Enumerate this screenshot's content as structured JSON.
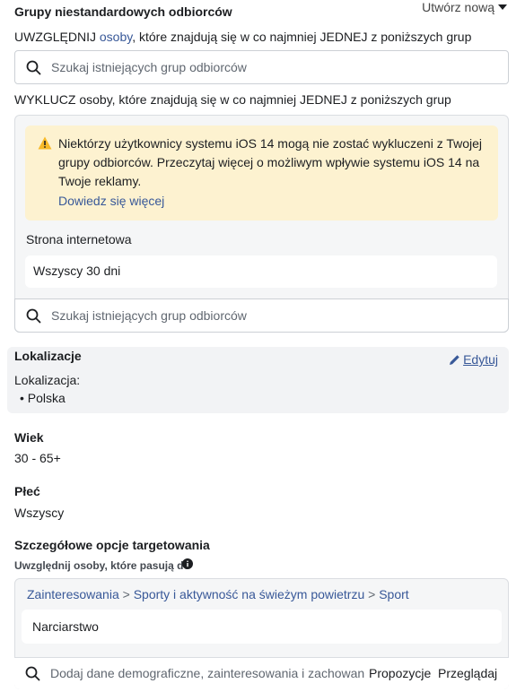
{
  "header": {
    "title": "Grupy niestandardowych odbiorców",
    "create_label": "Utwórz nową"
  },
  "include": {
    "prefix": "UWZGLĘDNIJ ",
    "link": "osoby",
    "suffix": ", które znajdują się w co najmniej JEDNEJ z poniższych grup",
    "search_placeholder": "Szukaj istniejących grup odbiorców"
  },
  "exclude": {
    "text": "WYKLUCZ osoby, które znajdują się w co najmniej JEDNEJ z poniższych grup",
    "warning_text": "Niektórzy użytkownicy systemu iOS 14 mogą nie zostać wykluczeni z Twojej grupy odbiorców. Przeczytaj więcej o możliwym wpływie systemu iOS 14 na Twoje reklamy.",
    "warning_link": "Dowiedz się więcej",
    "source_label": "Strona internetowa",
    "chip_label": "Wszyscy 30 dni",
    "search_placeholder": "Szukaj istniejących grup odbiorców"
  },
  "location": {
    "heading": "Lokalizacje",
    "edit_label": "Edytuj",
    "sub_label": "Lokalizacja:",
    "items": [
      "Polska"
    ]
  },
  "age": {
    "heading": "Wiek",
    "value": "30 - 65+"
  },
  "gender": {
    "heading": "Płeć",
    "value": "Wszyscy"
  },
  "detailed": {
    "heading": "Szczegółowe opcje targetowania",
    "sub_label": "Uwzględnij osoby, które pasują do",
    "crumbs": [
      "Zainteresowania",
      "Sporty i aktywność na świeżym powietrzu",
      "Sport"
    ],
    "chip_label": "Narciarstwo",
    "search_placeholder": "Dodaj dane demograficzne, zainteresowania i zachowan",
    "suggest_label": "Propozycje",
    "browse_label": "Przeglądaj"
  },
  "colors": {
    "link": "#385898",
    "warning_bg": "#fdf2d0",
    "warning_icon": "#f7b928"
  }
}
